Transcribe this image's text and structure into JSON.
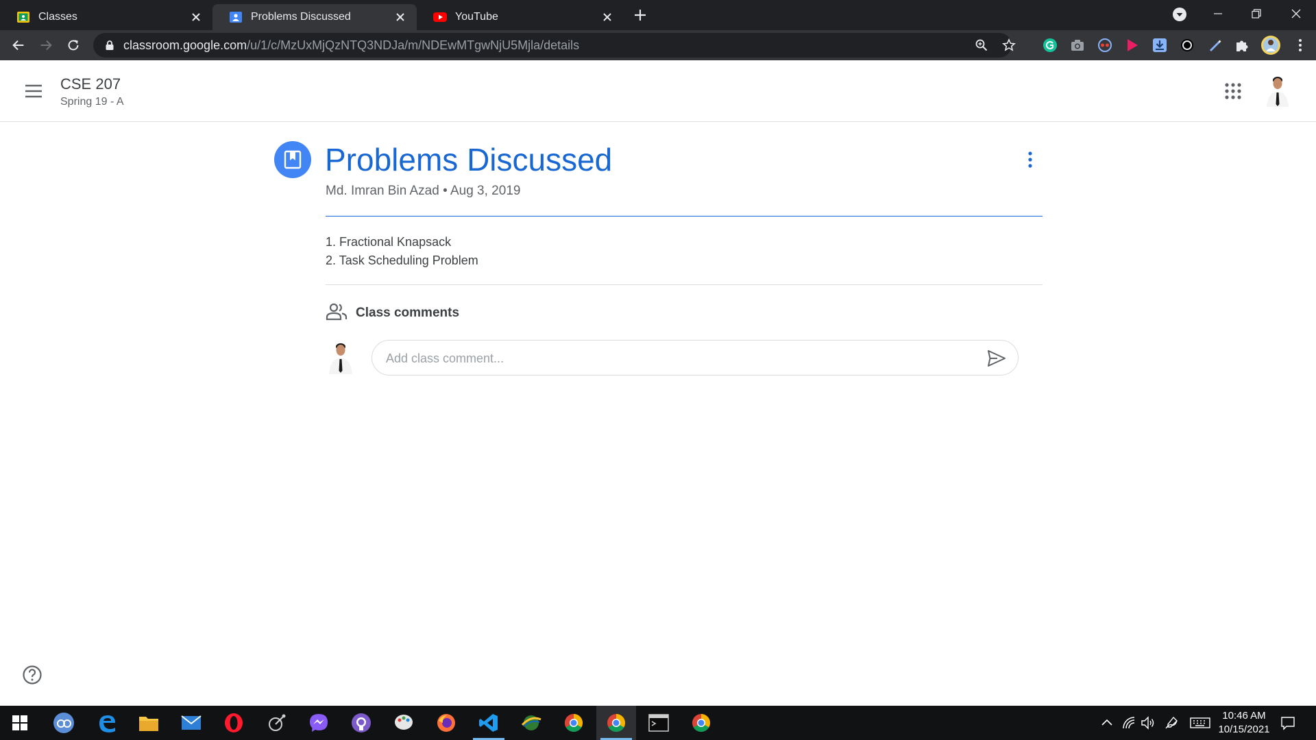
{
  "browser": {
    "tabs": [
      {
        "title": "Classes",
        "favicon": "classroom-yellow-icon",
        "active": false
      },
      {
        "title": "Problems Discussed",
        "favicon": "classroom-blue-icon",
        "active": true
      },
      {
        "title": "YouTube",
        "favicon": "youtube-icon",
        "active": false
      }
    ],
    "address": {
      "host": "classroom.google.com",
      "path": "/u/1/c/MzUxMjQzNTQ3NDJa/m/NDEwMTgwNjU5Mjla/details"
    },
    "extensions": [
      "grammarly-icon",
      "camera-icon",
      "extension-icon",
      "play-icon",
      "download-icon",
      "extension-icon",
      "pen-icon",
      "puzzle-icon"
    ]
  },
  "classroom": {
    "class_name": "CSE 207",
    "section": "Spring 19 - A",
    "post": {
      "title": "Problems Discussed",
      "author": "Md. Imran Bin Azad",
      "separator": "•",
      "date": "Aug 3, 2019",
      "items": [
        "1. Fractional Knapsack",
        "2. Task Scheduling Problem"
      ]
    },
    "comments": {
      "title": "Class comments",
      "placeholder": "Add class comment..."
    }
  },
  "taskbar": {
    "time": "10:46 AM",
    "date": "10/15/2021",
    "accent": "#76b9ed"
  },
  "colors": {
    "title_blue": "#1967d2",
    "icon_blue": "#4285f4",
    "chrome_dark": "#202124",
    "chrome_toolbar": "#35363a"
  }
}
